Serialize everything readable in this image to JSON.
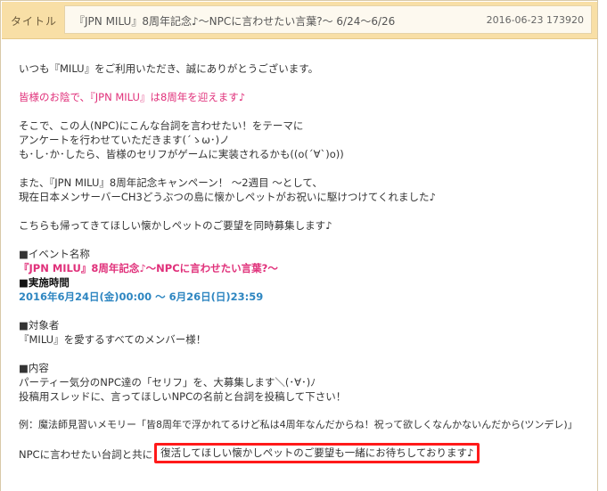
{
  "header": {
    "label": "タイトル",
    "title": "『JPN MILU』8周年記念♪～NPCに言わせたい言葉?～ 6/24～6/26",
    "date": "2016-06-23 173920"
  },
  "body": {
    "greeting": "いつも『MILU』をご利用いただき、誠にありがとうございます。",
    "anniversary": "皆様のお陰で、『JPN MILU』は8周年を迎えます♪",
    "survey": [
      "そこで、この人(NPC)にこんな台詞を言わせたい！をテーマに",
      "アンケートを行わせていただきます(´ゝω･)ノ",
      "も･し･か･したら、皆様のセリフがゲームに実装されるかも((o(´∀`)o))"
    ],
    "campaign": [
      "また、『JPN MILU』8周年記念キャンペーン！ ～2週目 ～として、",
      "現在日本メンサーバーCH3どうぶつの島に懐かしペットがお祝いに駆けつけてくれました♪"
    ],
    "pet_request": "こちらも帰ってきてほしい懐かしペットのご要望を同時募集します♪",
    "event_name_heading": "■イベント名称",
    "event_name": "『JPN MILU』8周年記念♪～NPCに言わせたい言葉?～",
    "period_heading": "■実施時間",
    "period": "2016年6月24日(金)00:00 ～ 6月26日(日)23:59",
    "target_heading": "■対象者",
    "target": "『MILU』を愛するすべてのメンバー様！",
    "content_heading": "■内容",
    "content": [
      "パーティー気分のNPC達の「セリフ」を、大募集します＼(･∀･)ﾉ",
      "投稿用スレッドに、言ってほしいNPCの名前と台詞を投稿して下さい！"
    ],
    "example": "例：魔法師見習いメモリー「皆8周年で浮かれてるけど私は4周年なんだからね！祝って欲しくなんかないんだから(ツンデレ)」",
    "final_prefix": "NPCに言わせたい台詞と共に",
    "final_highlight": "復活してほしい懐かしペットのご要望も一緒にお待ちしております♪"
  }
}
